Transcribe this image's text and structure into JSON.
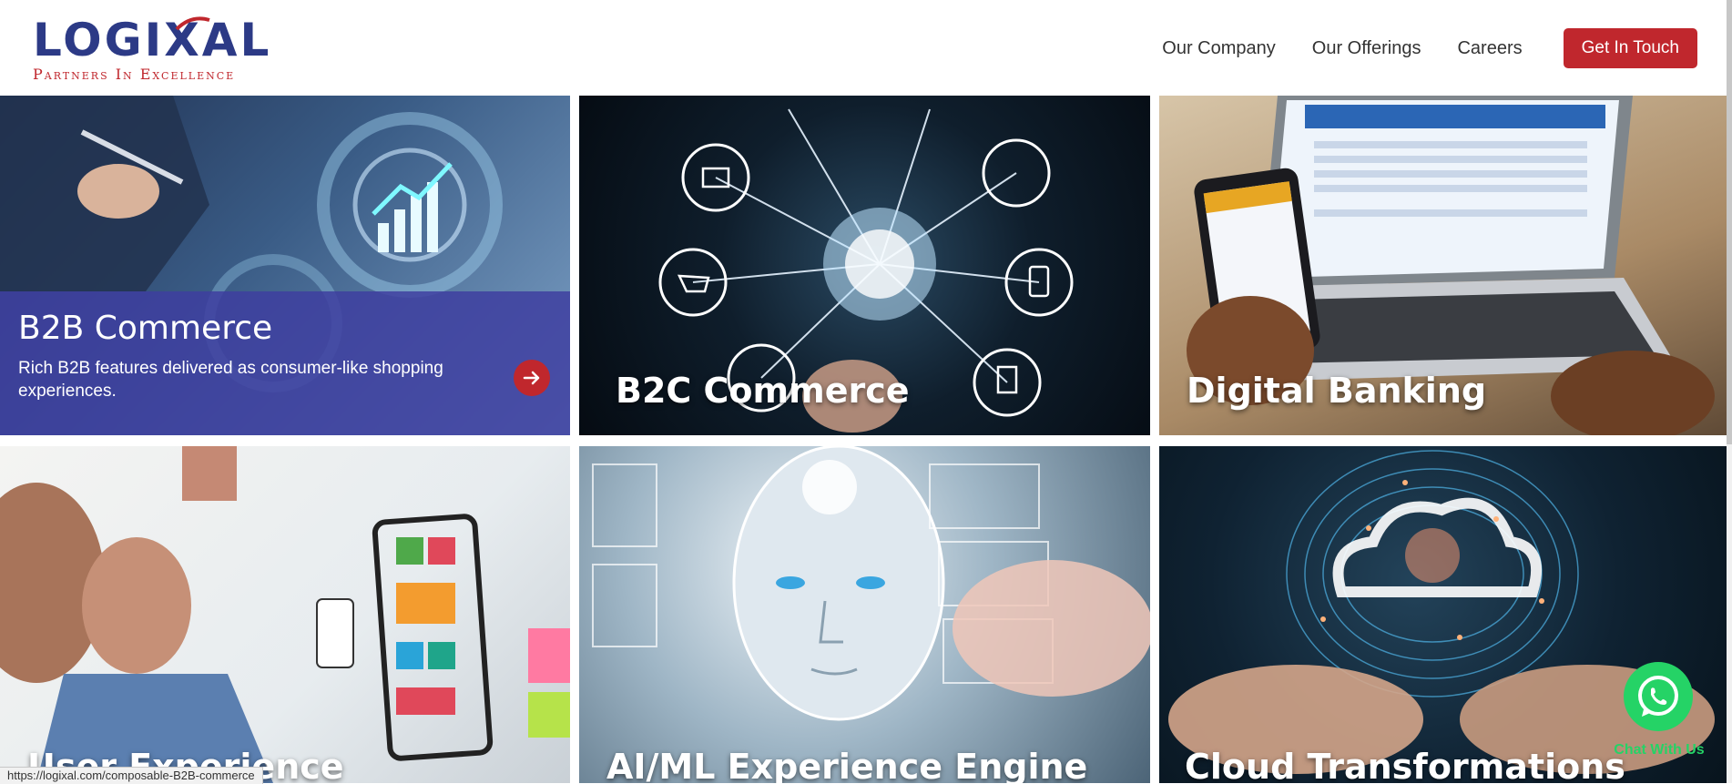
{
  "brand": {
    "name": "LOGIXAL",
    "tagline": "Partners In Excellence",
    "primary_color": "#2c3a86",
    "accent_color": "#c0272d"
  },
  "nav": {
    "items": [
      "Our Company",
      "Our Offerings",
      "Careers"
    ],
    "cta_label": "Get In Touch"
  },
  "tiles": [
    {
      "title": "B2B Commerce",
      "description": "Rich B2B features delivered as consumer-like shopping experiences.",
      "icon": "arrow-right-icon",
      "state": "hover"
    },
    {
      "title": "B2C Commerce"
    },
    {
      "title": "Digital Banking"
    },
    {
      "title": "User Experience"
    },
    {
      "title": "AI/ML Experience Engine"
    },
    {
      "title": "Cloud Transformations"
    }
  ],
  "chat": {
    "label": "Chat With Us",
    "icon": "whatsapp-icon",
    "color": "#25d366"
  },
  "status_bar": {
    "url": "https://logixal.com/composable-B2B-commerce"
  }
}
